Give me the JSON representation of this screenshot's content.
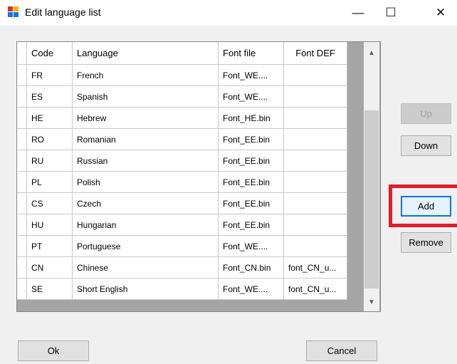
{
  "window": {
    "title": "Edit language list",
    "icon": "app-icon",
    "minimize": "—",
    "maximize": "☐",
    "close": "✕"
  },
  "grid": {
    "headers": {
      "code": "Code",
      "language": "Language",
      "font_file": "Font file",
      "font_def": "Font DEF"
    },
    "rows": [
      {
        "code": "FR",
        "language": "French",
        "font_file": "Font_WE....",
        "font_def": ""
      },
      {
        "code": "ES",
        "language": "Spanish",
        "font_file": "Font_WE....",
        "font_def": ""
      },
      {
        "code": "HE",
        "language": "Hebrew",
        "font_file": "Font_HE.bin",
        "font_def": ""
      },
      {
        "code": "RO",
        "language": "Romanian",
        "font_file": "Font_EE.bin",
        "font_def": ""
      },
      {
        "code": "RU",
        "language": "Russian",
        "font_file": "Font_EE.bin",
        "font_def": ""
      },
      {
        "code": "PL",
        "language": "Polish",
        "font_file": "Font_EE.bin",
        "font_def": ""
      },
      {
        "code": "CS",
        "language": "Czech",
        "font_file": "Font_EE.bin",
        "font_def": ""
      },
      {
        "code": "HU",
        "language": "Hungarian",
        "font_file": "Font_EE.bin",
        "font_def": ""
      },
      {
        "code": "PT",
        "language": "Portuguese",
        "font_file": "Font_WE....",
        "font_def": ""
      },
      {
        "code": "CN",
        "language": "Chinese",
        "font_file": "Font_CN.bin",
        "font_def": "font_CN_u..."
      },
      {
        "code": "SE",
        "language": "Short English",
        "font_file": "Font_WE....",
        "font_def": "font_CN_u..."
      }
    ]
  },
  "buttons": {
    "up": "Up",
    "down": "Down",
    "add": "Add",
    "remove": "Remove",
    "ok": "Ok",
    "cancel": "Cancel"
  },
  "colors": {
    "highlight": "#e11d2a",
    "accent": "#0078d7"
  }
}
